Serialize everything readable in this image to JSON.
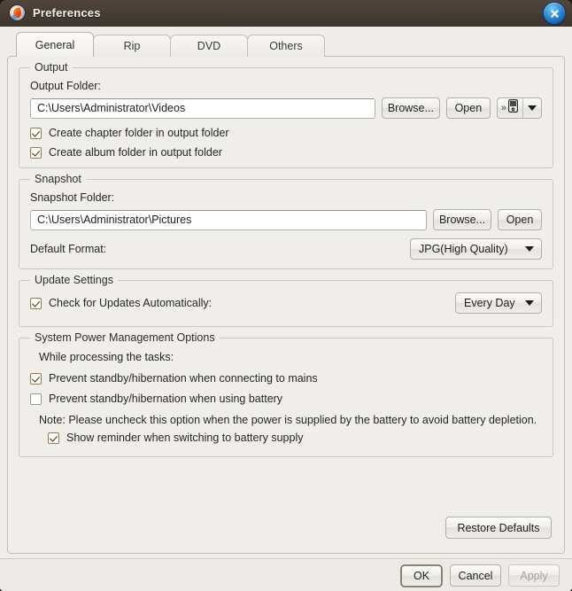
{
  "window": {
    "title": "Preferences",
    "app_icon": "disc-icon",
    "close_icon": "close-icon",
    "titlebar_color": "#453c34",
    "body_color": "#efedea"
  },
  "tabs": [
    {
      "label": "General",
      "active": true
    },
    {
      "label": "Rip",
      "active": false
    },
    {
      "label": "DVD",
      "active": false
    },
    {
      "label": "Others",
      "active": false
    }
  ],
  "output_group": {
    "legend": "Output",
    "folder_label": "Output Folder:",
    "folder_value": "C:\\Users\\Administrator\\Videos",
    "browse_label": "Browse...",
    "open_label": "Open",
    "device_button_icon": "portable-device-icon",
    "device_button_chevron": "»",
    "dropdown_icon": "chevron-down-icon",
    "checkboxes": [
      {
        "label": "Create chapter folder in output folder",
        "checked": true
      },
      {
        "label": "Create album folder in output folder",
        "checked": true
      }
    ]
  },
  "snapshot_group": {
    "legend": "Snapshot",
    "folder_label": "Snapshot Folder:",
    "folder_value": "C:\\Users\\Administrator\\Pictures",
    "browse_label": "Browse...",
    "open_label": "Open",
    "format_label": "Default Format:",
    "format_value": "JPG(High Quality)"
  },
  "update_group": {
    "legend": "Update Settings",
    "checkbox": {
      "label": "Check for Updates Automatically:",
      "checked": true
    },
    "frequency_value": "Every Day"
  },
  "power_group": {
    "legend": "System Power Management Options",
    "subtitle": "While processing the tasks:",
    "option_mains": {
      "label": "Prevent standby/hibernation when connecting to mains",
      "checked": true
    },
    "option_battery": {
      "label": "Prevent standby/hibernation when using battery",
      "checked": false
    },
    "note": "Note: Please uncheck this option when the power is supplied by the battery to avoid battery depletion.",
    "option_reminder": {
      "label": "Show reminder when switching to battery supply",
      "checked": true
    }
  },
  "restore_button": {
    "label": "Restore Defaults"
  },
  "footer": {
    "ok_label": "OK",
    "cancel_label": "Cancel",
    "apply_label": "Apply",
    "apply_disabled": true
  }
}
